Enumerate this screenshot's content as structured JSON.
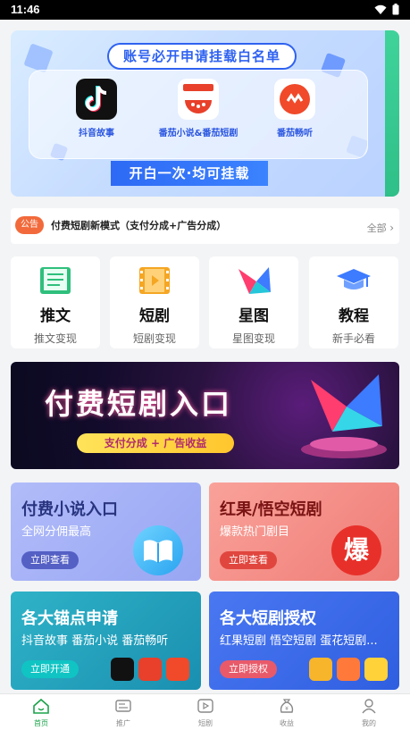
{
  "status": {
    "time": "11:46"
  },
  "hero": {
    "title": "账号必开申请挂载白名单",
    "apps": [
      {
        "label": "抖音故事",
        "icon": "tiktok-icon"
      },
      {
        "label": "番茄小说&番茄短剧",
        "icon": "tomato-novel-icon"
      },
      {
        "label": "番茄畅听",
        "icon": "tomato-listen-icon"
      }
    ],
    "bottom": "开白一次·均可挂载"
  },
  "notice": {
    "badge": "公告",
    "text": "付费短剧新模式（支付分成+广告分成）",
    "all": "全部"
  },
  "categories": [
    {
      "title": "推文",
      "sub": "推文变现",
      "icon": "book-icon"
    },
    {
      "title": "短剧",
      "sub": "短剧变现",
      "icon": "film-icon"
    },
    {
      "title": "星图",
      "sub": "星图变现",
      "icon": "star-map-icon"
    },
    {
      "title": "教程",
      "sub": "新手必看",
      "icon": "graduation-cap-icon"
    }
  ],
  "drama_banner": {
    "title": "付费短剧入口",
    "pill": "支付分成 + 广告收益"
  },
  "cards": [
    {
      "title": "付费小说入口",
      "sub": "全网分佣最高",
      "button": "立即查看",
      "bg": "#a8b5f7"
    },
    {
      "title": "红果/悟空短剧",
      "sub": "爆款热门剧目",
      "button": "立即查看",
      "big_char": "爆",
      "bg": "#f2857e"
    },
    {
      "title": "各大锚点申请",
      "sub": "抖音故事 番茄小说 番茄畅听",
      "button": "立即开通",
      "bg": "#1fa3b8"
    },
    {
      "title": "各大短剧授权",
      "sub": "红果短剧 悟空短剧 蛋花短剧...",
      "button": "立即授权",
      "bg": "#3d6ef0"
    }
  ],
  "nav": [
    {
      "label": "首页",
      "icon": "home-icon",
      "active": true
    },
    {
      "label": "推广",
      "icon": "promote-icon"
    },
    {
      "label": "短剧",
      "icon": "play-icon"
    },
    {
      "label": "收益",
      "icon": "money-bag-icon"
    },
    {
      "label": "我的",
      "icon": "user-icon"
    }
  ],
  "colors": {
    "accent_green": "#1aa34a",
    "notice_orange": "#f26a3b",
    "hero_blue": "#2f62f0"
  }
}
